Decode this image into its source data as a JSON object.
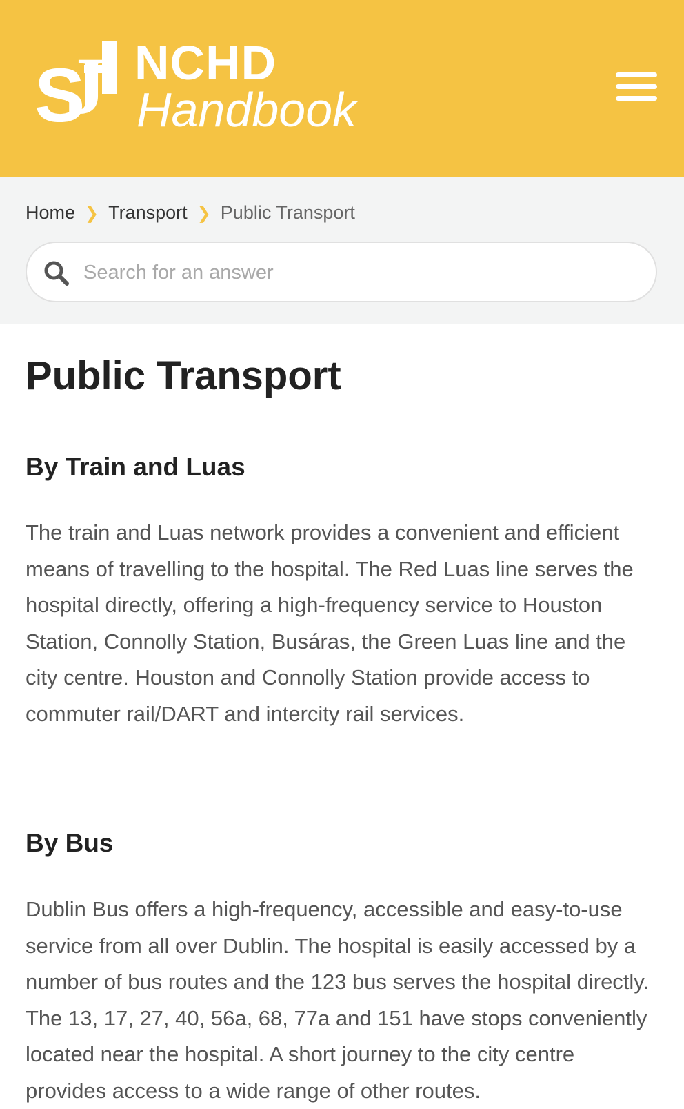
{
  "header": {
    "logo_mark": "SJH",
    "logo_line1": "NCHD",
    "logo_line2": "Handbook",
    "brand_color": "#f5c343"
  },
  "breadcrumb": {
    "items": [
      "Home",
      "Transport",
      "Public Transport"
    ],
    "separator_icon": "chevron-right-icon"
  },
  "search": {
    "placeholder": "Search for an answer",
    "value": ""
  },
  "main": {
    "title": "Public Transport",
    "sections": [
      {
        "heading": "By Train and Luas",
        "body": "The train and Luas network provides a convenient and efficient means of travelling to the hospital. The Red Luas line serves the hospital directly, offering a high-frequency service to Houston Station, Connolly Station, Busáras, the Green Luas line and the city centre. Houston and Connolly Station provide access to commuter rail/DART and intercity rail services."
      },
      {
        "heading": "By Bus",
        "body": "Dublin Bus offers a high-frequency, accessible and easy-to-use service from all over Dublin. The hospital is easily accessed by a number of bus routes and the 123 bus serves the hospital directly. The 13, 17, 27, 40, 56a, 68, 77a and 151 have stops conveniently located near the hospital. A short journey to the city centre provides access to a wide range of other routes."
      }
    ]
  }
}
